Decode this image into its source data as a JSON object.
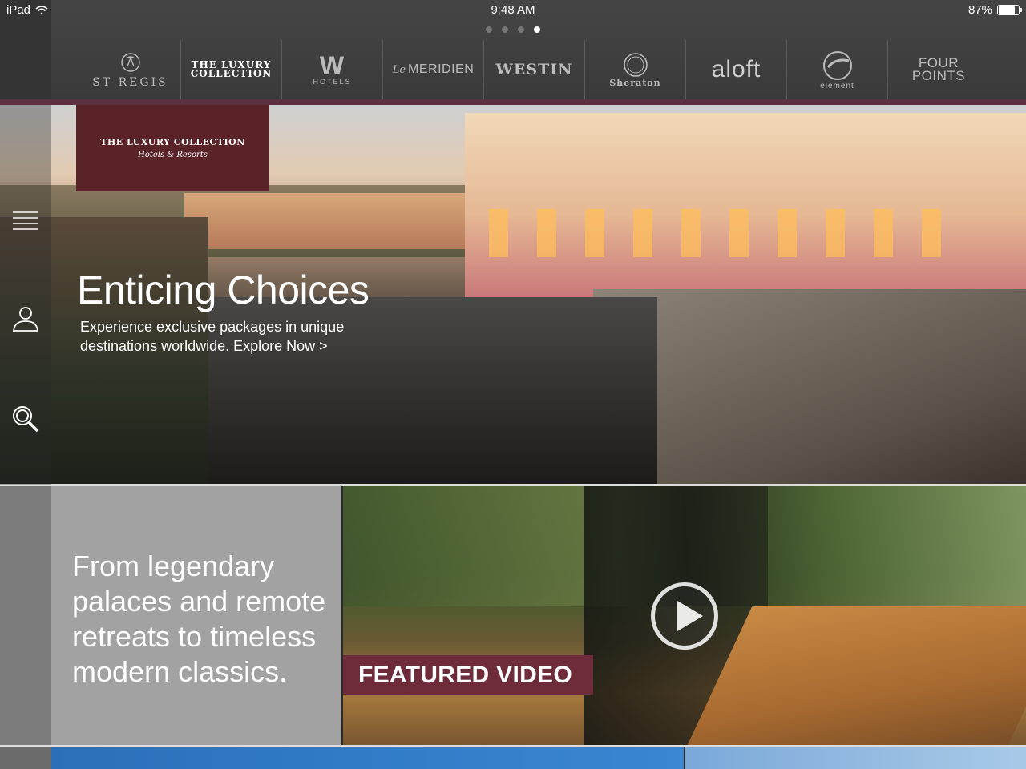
{
  "status_bar": {
    "device": "iPad",
    "time": "9:48 AM",
    "battery_percent": "87%",
    "battery_level": 0.87
  },
  "pager": {
    "count": 4,
    "active_index": 3
  },
  "brands": [
    {
      "id": "st-regis",
      "label": "ST REGIS"
    },
    {
      "id": "luxury-collection",
      "label_line1": "THE LUXURY",
      "label_line2": "COLLECTION"
    },
    {
      "id": "w-hotels",
      "mark": "W",
      "label": "HOTELS"
    },
    {
      "id": "le-meridien",
      "prefix": "Le",
      "label": "MERIDIEN"
    },
    {
      "id": "westin",
      "label": "WESTIN"
    },
    {
      "id": "sheraton",
      "mark": "S",
      "label": "Sheraton"
    },
    {
      "id": "aloft",
      "label": "aloft"
    },
    {
      "id": "element",
      "label": "element"
    },
    {
      "id": "four-points",
      "label_line1": "FOUR",
      "label_line2": "POINTS"
    }
  ],
  "hero": {
    "badge_title": "THE LUXURY COLLECTION",
    "badge_subtitle": "Hotels & Resorts",
    "title": "Enticing Choices",
    "subtitle": "Experience exclusive packages in unique destinations worldwide. Explore Now >"
  },
  "tagline": "From legendary palaces and remote retreats to timeless modern classics.",
  "video": {
    "label": "FEATURED VIDEO"
  },
  "icons": [
    "menu-icon",
    "profile-icon",
    "search-icon",
    "wifi-icon",
    "battery-icon",
    "play-icon"
  ],
  "colors": {
    "accent": "#6e2c3a",
    "badge": "#5a2328",
    "header": "#3f3f3f"
  }
}
